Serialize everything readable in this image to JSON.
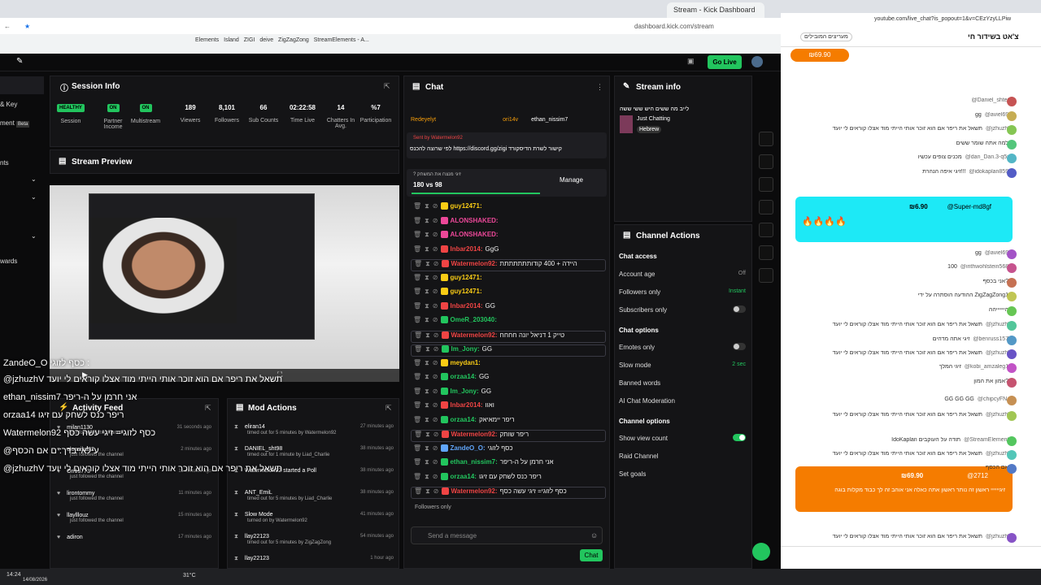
{
  "browser": {
    "tabs": [
      "Stream - Kick Dashboard"
    ],
    "url": "dashboard.kick.com/stream",
    "bookmarks": [
      "Elements",
      "Island",
      "ZIGI",
      "deive",
      "ZigZagZong",
      "StreamElements - A..."
    ]
  },
  "topnav": {
    "go_live": "Go Live"
  },
  "sidebar": {
    "items": [
      "& Key",
      "ment",
      "Beta",
      "nts",
      "wards"
    ]
  },
  "session": {
    "title": "Session Info",
    "stats": [
      {
        "value": "HEALTHY",
        "label": "Session",
        "badge": true
      },
      {
        "value": "ON",
        "label": "Partner Income",
        "badge": true
      },
      {
        "value": "ON",
        "label": "Multistream",
        "badge": true
      },
      {
        "value": "189",
        "label": "Viewers"
      },
      {
        "value": "8,101",
        "label": "Followers"
      },
      {
        "value": "66",
        "label": "Sub Counts"
      },
      {
        "value": "02:22:58",
        "label": "Time Live"
      },
      {
        "value": "14",
        "label": "Chatters In Avg."
      },
      {
        "value": "%7",
        "label": "Participation"
      }
    ]
  },
  "preview": {
    "title": "Stream Preview",
    "overlay": [
      "ZandeO_O כסף לזוגי :",
      "@jzhuzhV תשאל את ריפר אם הוא זוכר אותי הייתי מוד אצלו קוראים לי יועד",
      "ethan_nissim7 אני חרמן על ה-ריפר",
      "orzaa14 ריפר כנס לשחק עם זיגו",
      "Watermelon92 כסף לזוגי= זיגי עשה כסף",
      "@עילאייבדך: ם אם הכסף",
      "@jzhuzhV תשאל את ריפר אם הוא זוכר אותי הייתי מוד אצלו קוראים לי יועד"
    ]
  },
  "activity": {
    "title": "Activity Feed",
    "items": [
      {
        "name": "milan1130",
        "sub": "just followed the channel",
        "time": "31 seconds ago"
      },
      {
        "name": "elonsiha22",
        "sub": "just followed the channel",
        "time": "2 minutes ago"
      },
      {
        "name": "Ori13773",
        "sub": "just followed the channel",
        "time": "11 minutes ago"
      },
      {
        "name": "lirontommy",
        "sub": "just followed the channel",
        "time": "11 minutes ago"
      },
      {
        "name": "llaylllouz",
        "sub": "just followed the channel",
        "time": "15 minutes ago"
      },
      {
        "name": "adiron",
        "sub": "",
        "time": "17 minutes ago"
      }
    ]
  },
  "modactions": {
    "title": "Mod Actions",
    "items": [
      {
        "name": "eliran14",
        "sub": "timed out for 5 minutes by Watermelon92",
        "time": "27 minutes ago"
      },
      {
        "name": "DANIEL_sht98",
        "sub": "timed out for 1 minute by Liad_Charlie",
        "time": "38 minutes ago"
      },
      {
        "name": "Watermelon92 started a Poll",
        "sub": "",
        "time": "38 minutes ago"
      },
      {
        "name": "ANT_EmiL",
        "sub": "timed out for 5 minutes by Liad_Charlie",
        "time": "38 minutes ago"
      },
      {
        "name": "Slow Mode",
        "sub": "turned on by Watermelon92",
        "time": "41 minutes ago"
      },
      {
        "name": "llay22123",
        "sub": "timed out for 5 minutes by ZigZagZong",
        "time": "54 minutes ago"
      },
      {
        "name": "llay22123",
        "sub": "",
        "time": "1 hour ago"
      }
    ]
  },
  "chat": {
    "title": "Chat",
    "pinned_users": [
      "Redeyelyt",
      "ori14v",
      "ethan_nissim7"
    ],
    "pinned_sender": "Sent by Watermelon92",
    "pinned_text": "לפי שרוצה להכנס https://discord.gg/zigi קישור לשרת הדיסקורד",
    "poll_question": "? זיגי מנצח את המשחק",
    "poll_result": "180 vs 98",
    "poll_manage": "Manage",
    "messages": [
      {
        "user": "guy12471:",
        "text": "",
        "color": "#facc15",
        "hl": false
      },
      {
        "user": "ALONSHAKED:",
        "text": "",
        "color": "#ec4899",
        "hl": false
      },
      {
        "user": "ALONSHAKED:",
        "text": "",
        "color": "#ec4899",
        "hl": false
      },
      {
        "user": "Inbar2014:",
        "text": "GgG",
        "color": "#ef4444",
        "hl": false
      },
      {
        "user": "Watermelon92:",
        "text": "היידה + 400 קודותתתתתתת",
        "color": "#ef4444",
        "hl": true
      },
      {
        "user": "guy12471:",
        "text": "",
        "color": "#facc15",
        "hl": false
      },
      {
        "user": "guy12471:",
        "text": "",
        "color": "#facc15",
        "hl": false
      },
      {
        "user": "Inbar2014:",
        "text": "GG",
        "color": "#ef4444",
        "hl": false
      },
      {
        "user": "OmeR_203040:",
        "text": "",
        "color": "#22c55e",
        "hl": false
      },
      {
        "user": "Watermelon92:",
        "text": "טייק 1 דניאל יונה חחחח",
        "color": "#ef4444",
        "hl": true
      },
      {
        "user": "Im_Jony:",
        "text": "GG",
        "color": "#22c55e",
        "hl": true
      },
      {
        "user": "meydan1:",
        "text": "",
        "color": "#facc15",
        "hl": false
      },
      {
        "user": "orzaa14:",
        "text": "GG",
        "color": "#22c55e",
        "hl": false
      },
      {
        "user": "Im_Jony:",
        "text": "GG",
        "color": "#22c55e",
        "hl": false
      },
      {
        "user": "Inbar2014:",
        "text": "ואוו",
        "color": "#ef4444",
        "hl": false
      },
      {
        "user": "orzaa14:",
        "text": "ריפר יימאיאק",
        "color": "#22c55e",
        "hl": false
      },
      {
        "user": "Watermelon92:",
        "text": "ריפר שותק",
        "color": "#ef4444",
        "hl": true
      },
      {
        "user": "ZandeO_O:",
        "text": "כסף לזוגי",
        "color": "#60a5fa",
        "hl": false
      },
      {
        "user": "ethan_nissim7:",
        "text": "אני חרמן על ה-ריפר",
        "color": "#22c55e",
        "hl": false
      },
      {
        "user": "orzaa14:",
        "text": "ריפר כנס לשחק עם זיגו",
        "color": "#22c55e",
        "hl": false
      },
      {
        "user": "Watermelon92:",
        "text": "כסף לזוגי= זיגי עשה כסף",
        "color": "#ef4444",
        "hl": true
      }
    ],
    "followers_only": "Followers only",
    "placeholder": "Send a message",
    "send": "Chat"
  },
  "streaminfo": {
    "title": "Stream info",
    "stream_title": "לייב מה ששים היש ששי ששה",
    "category": "Just Chatting",
    "tag": "Hebrew"
  },
  "channelactions": {
    "title": "Channel Actions",
    "chat_access": "Chat access",
    "account_age": "Account age",
    "account_age_val": "Off",
    "followers_only": "Followers only",
    "followers_only_val": "Instant",
    "subscribers_only": "Subscribers only",
    "chat_options": "Chat options",
    "emotes_only": "Emotes only",
    "slow_mode": "Slow mode",
    "slow_mode_val": "2 sec",
    "banned_words": "Banned words",
    "ai_mod": "AI Chat Moderation",
    "channel_options": "Channel options",
    "show_view_count": "Show view count",
    "raid": "Raid Channel",
    "set_goals": "Set goals"
  },
  "popout": {
    "url": "youtube.com/live_chat?is_popout=1&v=CEzYzyLLPiw",
    "title": "צ'אט בשידור חי",
    "top_supporters": "מעריצים המובילים",
    "top_amount": "₪69.90",
    "messages": [
      {
        "name": "@Daniel_shtein",
        "text": ""
      },
      {
        "name": "@aviel692",
        "text": "gg"
      },
      {
        "name": "@jzhuzhV",
        "text": "תשאל את ריפר אם הוא זוכר אותי הייתי מוד אצלו קוראים לי יועד"
      },
      {
        "name": "",
        "text": "למה אתה שומר ששים"
      },
      {
        "name": "@dan_Dan.3-q5m",
        "text": "מכנים צופים עכשיו"
      },
      {
        "name": "@idokaplan8596",
        "text": "זיגי איפה הנהרת!!!"
      },
      {
        "name": "@aviel692",
        "text": "gg"
      },
      {
        "name": "@irithwohlstein5684",
        "text": "100"
      },
      {
        "name": "",
        "text": "אני בכסף?"
      },
      {
        "name": "",
        "text": "ההודעה הוסתרה על ידי ZigZagZong1"
      },
      {
        "name": "",
        "text": "הייייייהה"
      },
      {
        "name": "@jzhuzhV",
        "text": "תשאל את ריפר אם הוא זוכר אותי הייתי מוד אצלו קוראים לי יועד"
      },
      {
        "name": "@benruss1573",
        "text": "זיגי אתה מדהים"
      },
      {
        "name": "@jzhuzhV",
        "text": "תשאל את ריפר אם הוא זוכר אותי הייתי מוד אצלו קוראים לי יועד"
      },
      {
        "name": "@kobi_amzaleg10",
        "text": "זיגי המלך"
      },
      {
        "name": "",
        "text": "אמון את המון?"
      },
      {
        "name": "@chipcyFN.1",
        "text": "GG GG GG"
      },
      {
        "name": "@jzhuzhV",
        "text": "תשאל את ריפר אם הוא זוכר אותי הייתי מוד אצלו קוראים לי יועד"
      },
      {
        "name": "@StreamElements",
        "text": "IdoKaplan תודה על העוקבים"
      },
      {
        "name": "@jzhuzhV",
        "text": "תשאל את ריפר אם הוא זוכר אותי הייתי מוד אצלו קוראים לי יועד"
      },
      {
        "name": "",
        "text": "אם הכסף"
      },
      {
        "name": "@jzhuzhV",
        "text": "תשאל את ריפר אם הוא זוכר אותי הייתי מוד אצלו קוראים לי יועד"
      }
    ],
    "super1": {
      "name": "@Super-md8gf",
      "amount": "₪6.90",
      "text": "🔥🔥🔥🔥"
    },
    "super2": {
      "name": "@2712",
      "amount": "₪69.90",
      "text": "זיגיייייי ראשון זה נותר ראשון אתה כאלה אני אוהב זה לך כבוד מקלות בוגה"
    }
  },
  "taskbar": {
    "weather": "31°C",
    "date": "14/08/2026",
    "time": "14:24"
  }
}
